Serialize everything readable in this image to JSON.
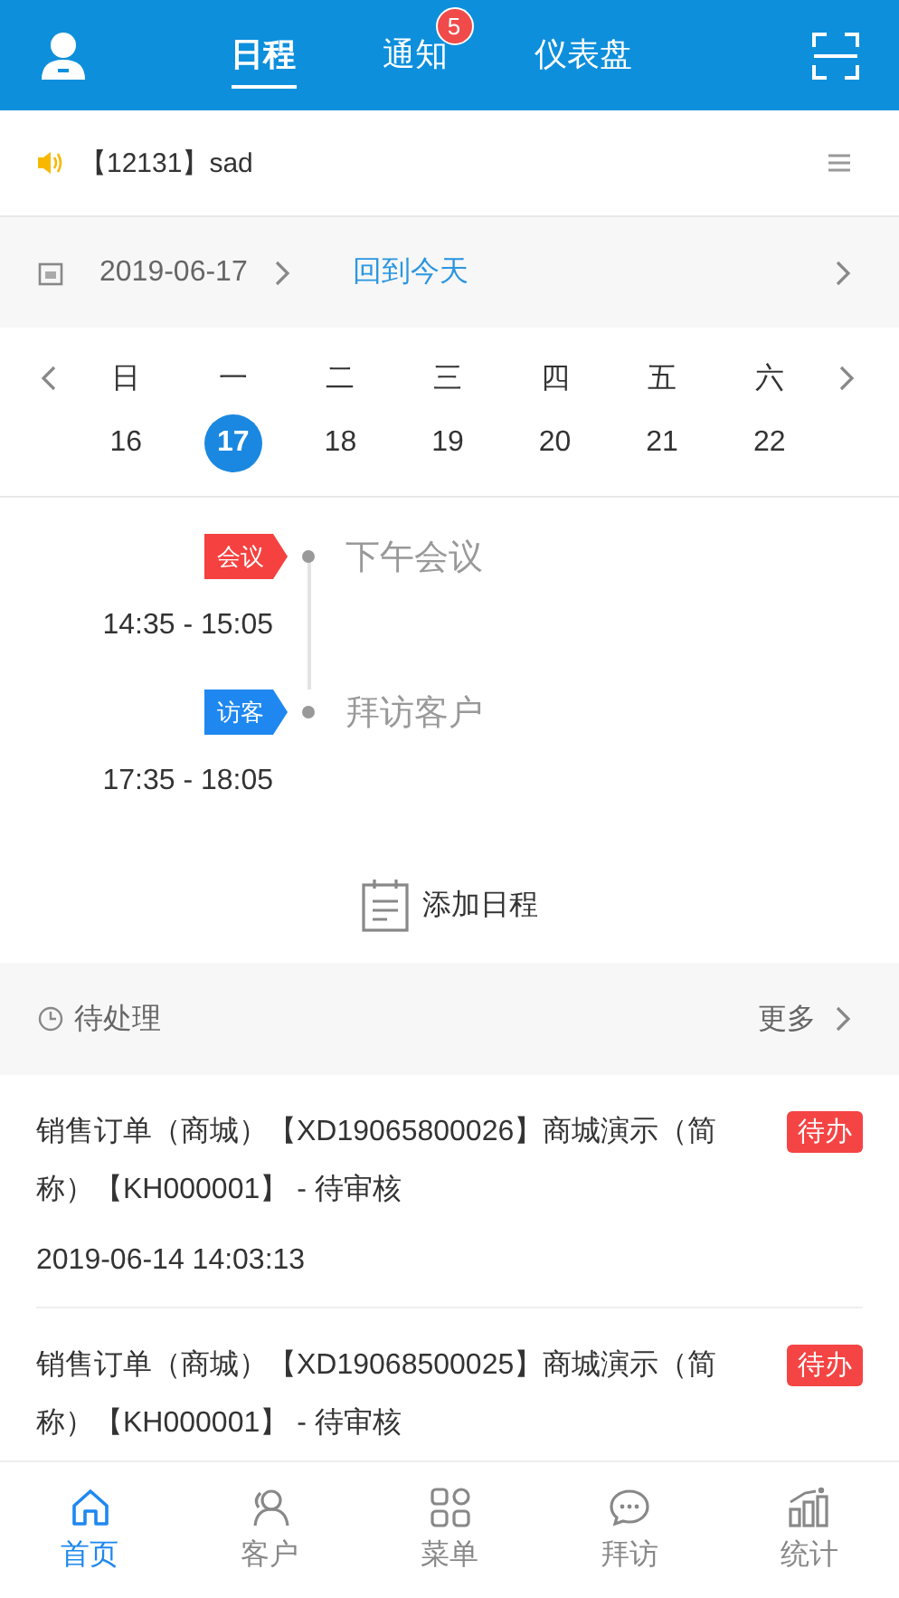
{
  "header": {
    "tabs": [
      {
        "label": "日程",
        "selected": true
      },
      {
        "label": "通知",
        "selected": false,
        "badge": "5"
      },
      {
        "label": "仪表盘",
        "selected": false
      }
    ]
  },
  "notice": {
    "text": "【12131】sad"
  },
  "date_bar": {
    "date": "2019-06-17",
    "today_link": "回到今天"
  },
  "week": {
    "weekdays": [
      "日",
      "一",
      "二",
      "三",
      "四",
      "五",
      "六"
    ],
    "days": [
      {
        "label": "16",
        "selected": false
      },
      {
        "label": "17",
        "selected": true
      },
      {
        "label": "18",
        "selected": false
      },
      {
        "label": "19",
        "selected": false
      },
      {
        "label": "20",
        "selected": false
      },
      {
        "label": "21",
        "selected": false
      },
      {
        "label": "22",
        "selected": false
      }
    ]
  },
  "schedule": [
    {
      "tag": "会议",
      "color": "#f5413f",
      "title": "下午会议",
      "time": "14:35 - 15:05"
    },
    {
      "tag": "访客",
      "color": "#1e88f0",
      "title": "拜访客户",
      "time": "17:35 - 18:05"
    }
  ],
  "add_schedule": "添加日程",
  "pending": {
    "title": "待处理",
    "more": "更多",
    "items": [
      {
        "text": "销售订单（商城）【XD19065800026】商城演示（简称）【KH000001】 - 待审核",
        "badge": "待办",
        "time": "2019-06-14 14:03:13"
      },
      {
        "text": "销售订单（商城）【XD19068500025】商城演示（简称）【KH000001】 - 待审核",
        "badge": "待办"
      }
    ]
  },
  "tab_bar": [
    {
      "label": "首页",
      "selected": true,
      "kind": "home"
    },
    {
      "label": "客户",
      "selected": false,
      "kind": "person"
    },
    {
      "label": "菜单",
      "selected": false,
      "kind": "grid"
    },
    {
      "label": "拜访",
      "selected": false,
      "kind": "chat"
    },
    {
      "label": "统计",
      "selected": false,
      "kind": "chart"
    }
  ]
}
